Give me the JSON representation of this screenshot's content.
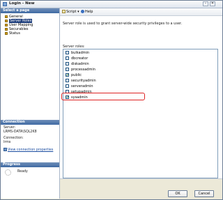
{
  "window": {
    "title": "Login - New"
  },
  "left": {
    "select_page_header": "Select a page",
    "pages": [
      {
        "label": "General"
      },
      {
        "label": "Server Roles"
      },
      {
        "label": "User Mapping"
      },
      {
        "label": "Securables"
      },
      {
        "label": "Status"
      }
    ],
    "connection": {
      "header": "Connection",
      "server_label": "Server:",
      "server_value": "LRMS-DATA\\SQL2K8",
      "connection_label": "Connection:",
      "connection_value": "lrms",
      "view_link": "View connection properties"
    },
    "progress": {
      "header": "Progress",
      "status": "Ready"
    }
  },
  "toolbar": {
    "script_label": "Script",
    "help_label": "Help"
  },
  "main": {
    "description": "Server role is used to grant server-wide security privileges to a user.",
    "roles_label": "Server roles:",
    "roles": [
      {
        "name": "bulkadmin",
        "checked": false
      },
      {
        "name": "dbcreator",
        "checked": false
      },
      {
        "name": "diskadmin",
        "checked": false
      },
      {
        "name": "processadmin",
        "checked": false
      },
      {
        "name": "public",
        "checked": true
      },
      {
        "name": "securityadmin",
        "checked": false
      },
      {
        "name": "serveradmin",
        "checked": false
      },
      {
        "name": "setupadmin",
        "checked": false
      },
      {
        "name": "sysadmin",
        "checked": true
      }
    ]
  },
  "buttons": {
    "ok": "OK",
    "cancel": "Cancel"
  },
  "check_glyph": "✔"
}
